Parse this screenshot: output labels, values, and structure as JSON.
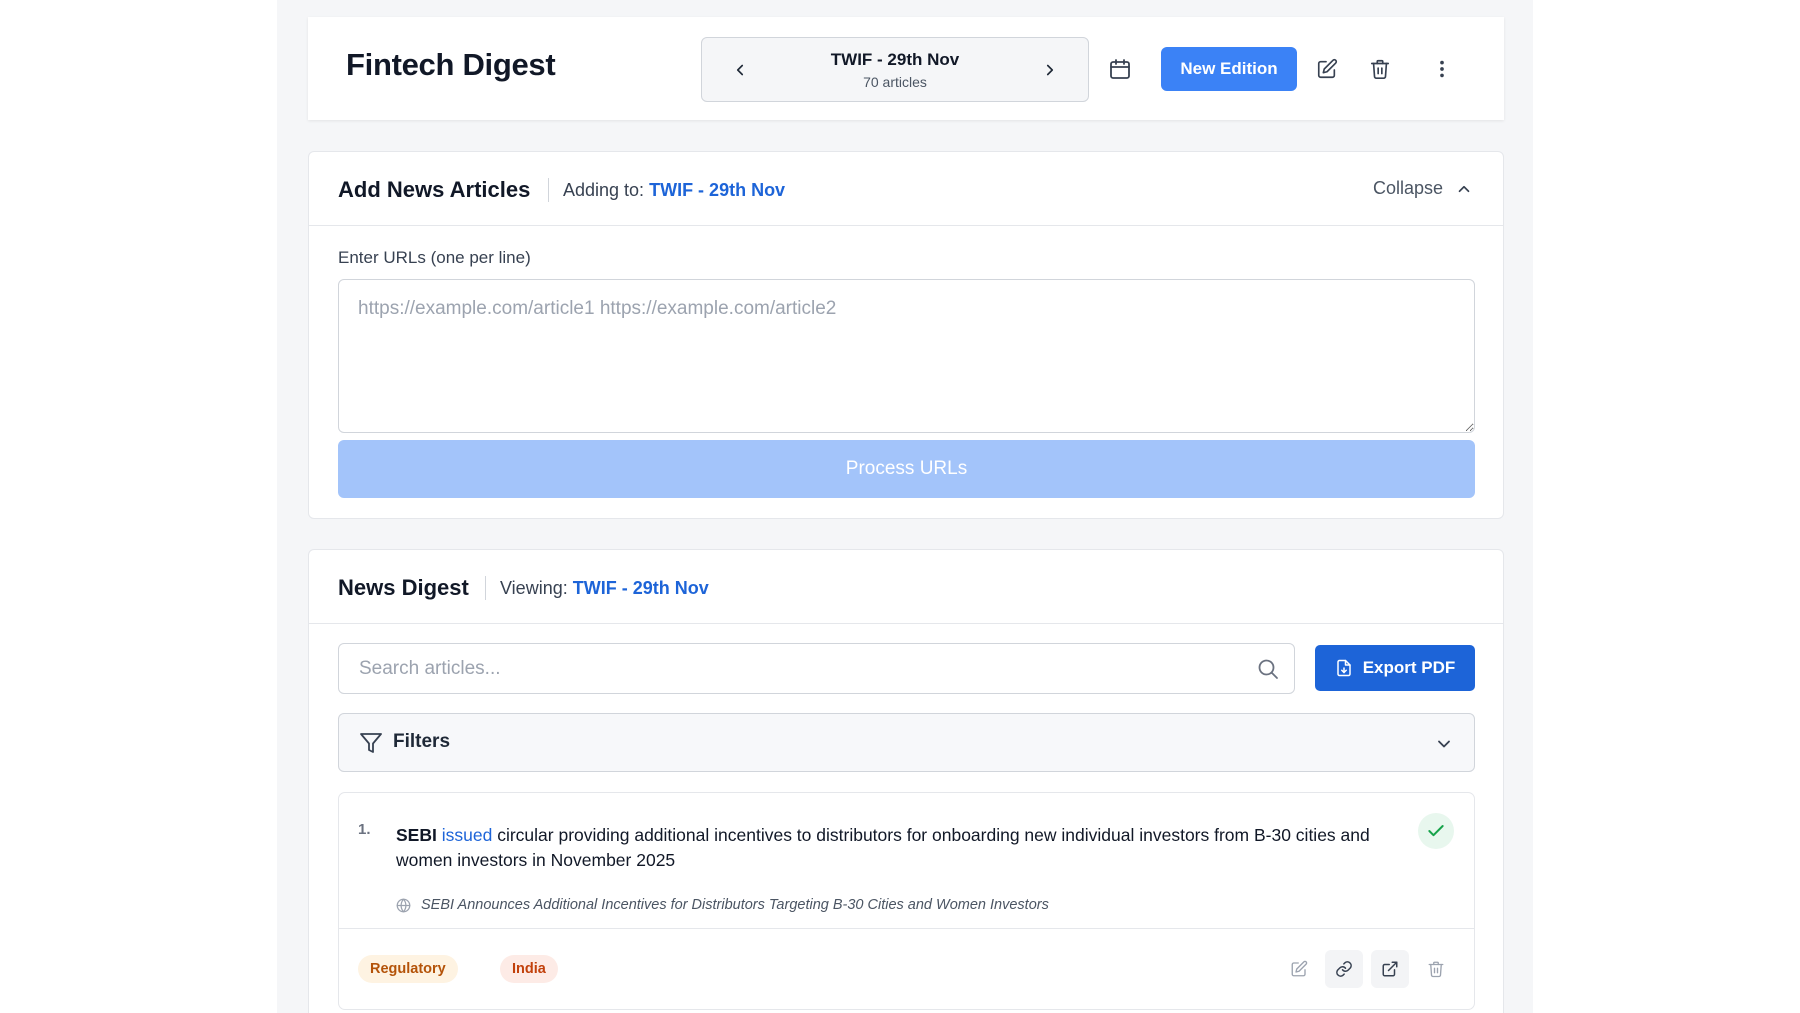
{
  "header": {
    "title": "Fintech Digest",
    "edition_name": "TWIF - 29th Nov",
    "edition_count": "70 articles",
    "new_edition_label": "New Edition"
  },
  "add_articles": {
    "title": "Add News Articles",
    "adding_to_prefix": "Adding to:",
    "adding_to_edition": "TWIF - 29th Nov",
    "collapse_label": "Collapse",
    "field_label": "Enter URLs (one per line)",
    "textarea_placeholder": "https://example.com/article1 https://example.com/article2",
    "textarea_value": "",
    "process_label": "Process URLs"
  },
  "digest": {
    "title": "News Digest",
    "viewing_prefix": "Viewing:",
    "viewing_edition": "TWIF - 29th Nov",
    "search_placeholder": "Search articles...",
    "search_value": "",
    "export_label": "Export PDF",
    "filters_label": "Filters",
    "articles": [
      {
        "number": "1.",
        "subject": "SEBI",
        "verb": "issued",
        "rest": "circular providing additional incentives to distributors for onboarding new individual investors from B-30 cities and women investors in November 2025",
        "source_title": "SEBI Announces Additional Incentives for Distributors Targeting B-30 Cities and Women Investors",
        "tags": [
          "Regulatory",
          "India"
        ],
        "status": "approved"
      }
    ]
  },
  "colors": {
    "primary": "#3b82f6",
    "primary_dark": "#1d64d8",
    "accent_link": "#1d64d8",
    "disabled_button": "#a3c4fa",
    "success": "#16a34a"
  },
  "icons": [
    "chevron-left-icon",
    "chevron-right-icon",
    "calendar-icon",
    "edit-icon",
    "trash-icon",
    "more-vertical-icon",
    "chevron-up-icon",
    "search-icon",
    "file-export-icon",
    "filter-icon",
    "chevron-down-icon",
    "check-icon",
    "globe-icon",
    "link-icon",
    "external-link-icon"
  ]
}
